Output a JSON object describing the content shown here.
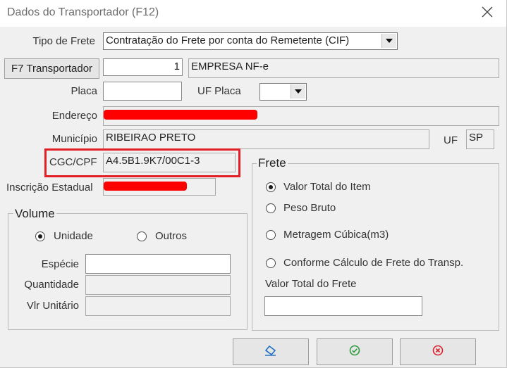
{
  "window": {
    "title": "Dados do Transportador  (F12)",
    "close_icon": "close-icon"
  },
  "tipo_frete": {
    "label": "Tipo de Frete",
    "value": "Contratação do Frete por conta do Remetente (CIF)"
  },
  "transportador": {
    "button_label": "F7  Transportador",
    "code": "1",
    "name": "EMPRESA NF-e"
  },
  "placa": {
    "label": "Placa",
    "value": "",
    "uf_label": "UF Placa",
    "uf_value": ""
  },
  "endereco": {
    "label": "Endereço"
  },
  "municipio": {
    "label": "Município",
    "value": "RIBEIRAO PRETO",
    "uf_label": "UF",
    "uf_value": "SP"
  },
  "cgc": {
    "label": "CGC/CPF",
    "value": "A4.5B1.9K7/00C1-3"
  },
  "inscricao": {
    "label": "Inscrição Estadual"
  },
  "volume": {
    "title": "Volume",
    "options": [
      {
        "label": "Unidade",
        "selected": true
      },
      {
        "label": "Outros",
        "selected": false
      }
    ],
    "especie_label": "Espécie",
    "quantidade_label": "Quantidade",
    "vlr_unitario_label": "Vlr Unitário"
  },
  "frete": {
    "title": "Frete",
    "options": [
      {
        "label": "Valor Total do Item",
        "selected": true
      },
      {
        "label": "Peso Bruto",
        "selected": false
      },
      {
        "label": "Metragem Cúbica(m3)",
        "selected": false
      },
      {
        "label": "Conforme Cálculo de Frete do Transp.",
        "selected": false
      }
    ],
    "valor_total_label": "Valor Total do Frete",
    "valor_total_value": ""
  },
  "footer": {
    "buttons": [
      "eraser-icon",
      "confirm-icon",
      "cancel-icon"
    ]
  },
  "colors": {
    "accent_red": "#e31e24",
    "redaction": "#ff0000",
    "confirm_green": "#2e9b3e",
    "cancel_red": "#d9232e",
    "eraser_blue": "#1f6fc4"
  }
}
